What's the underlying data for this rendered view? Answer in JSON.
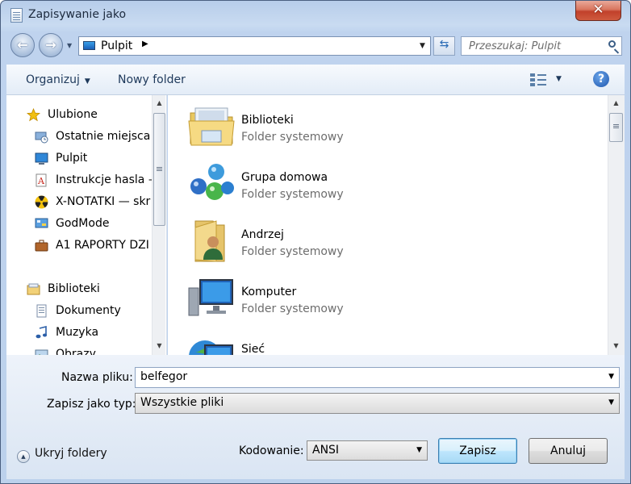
{
  "window": {
    "title": "Zapisywanie jako",
    "close_label": "✕"
  },
  "nav": {
    "back_icon": "back-arrow-icon",
    "forward_icon": "forward-arrow-icon",
    "address": "Pulpit",
    "search_placeholder": "Przeszukaj: Pulpit"
  },
  "toolbar": {
    "organize_label": "Organizuj",
    "new_folder_label": "Nowy folder",
    "help_label": "?"
  },
  "sidebar": {
    "items": [
      {
        "label": "Ulubione",
        "icon": "star-icon",
        "indent": 0
      },
      {
        "label": "Ostatnie miejsca",
        "icon": "recent-places-icon",
        "indent": 1
      },
      {
        "label": "Pulpit",
        "icon": "desktop-icon",
        "indent": 1
      },
      {
        "label": "Instrukcje hasla —",
        "icon": "pdf-document-icon",
        "indent": 1
      },
      {
        "label": "X-NOTATKI — skr",
        "icon": "radiation-icon",
        "indent": 1
      },
      {
        "label": "GodMode",
        "icon": "control-panel-icon",
        "indent": 1
      },
      {
        "label": "A1 RAPORTY  DZI",
        "icon": "briefcase-icon",
        "indent": 1
      },
      {
        "label": "Biblioteki",
        "icon": "libraries-icon",
        "indent": 0
      },
      {
        "label": "Dokumenty",
        "icon": "documents-icon",
        "indent": 1
      },
      {
        "label": "Muzyka",
        "icon": "music-icon",
        "indent": 1
      },
      {
        "label": "Obrazy",
        "icon": "pictures-icon",
        "indent": 1
      }
    ]
  },
  "content": {
    "items": [
      {
        "name": "Biblioteki",
        "type": "Folder systemowy",
        "icon": "libraries-folder-icon"
      },
      {
        "name": "Grupa domowa",
        "type": "Folder systemowy",
        "icon": "homegroup-icon"
      },
      {
        "name": "Andrzej",
        "type": "Folder systemowy",
        "icon": "user-folder-icon"
      },
      {
        "name": "Komputer",
        "type": "Folder systemowy",
        "icon": "computer-icon"
      },
      {
        "name": "Sieć",
        "type": "",
        "icon": "network-icon"
      }
    ]
  },
  "form": {
    "filename_label": "Nazwa pliku:",
    "filename_value": "belfegor",
    "filetype_label": "Zapisz jako typ:",
    "filetype_value": "Wszystkie pliki",
    "encoding_label": "Kodowanie:",
    "encoding_value": "ANSI",
    "hide_folders_label": "Ukryj foldery",
    "save_label": "Zapisz",
    "cancel_label": "Anuluj"
  }
}
